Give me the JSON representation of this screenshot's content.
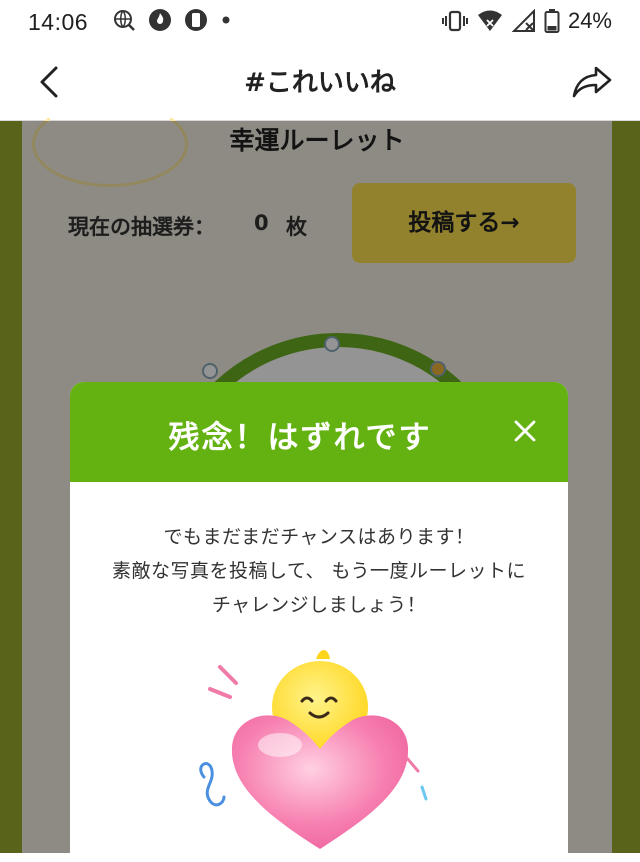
{
  "status_bar": {
    "time": "14:06",
    "battery_percent": "24%",
    "left_icons": [
      "globe-search-icon",
      "fire-app-icon",
      "phone-app-icon",
      "dot-icon"
    ],
    "right_icons": [
      "vibrate-icon",
      "wifi-icon",
      "no-signal-icon",
      "battery-icon"
    ]
  },
  "header": {
    "title": "#これいいね",
    "back_icon": "chevron-left-icon",
    "share_icon": "share-arrow-icon"
  },
  "card": {
    "title": "幸運ルーレット",
    "ticket_label": "現在の抽選券：",
    "ticket_count": "0",
    "ticket_unit": "枚",
    "post_button": "投稿する→"
  },
  "modal": {
    "title": "残念！はずれです",
    "close_icon": "close-icon",
    "lines": [
      "でもまだまだチャンスはあります！",
      "素敵な写真を投稿して、 もう一度ルーレットに",
      "チャレンジしましょう！"
    ]
  },
  "colors": {
    "header_green": "#64b212",
    "post_button_yellow": "#fde14e",
    "page_background": "#9cab2e"
  }
}
